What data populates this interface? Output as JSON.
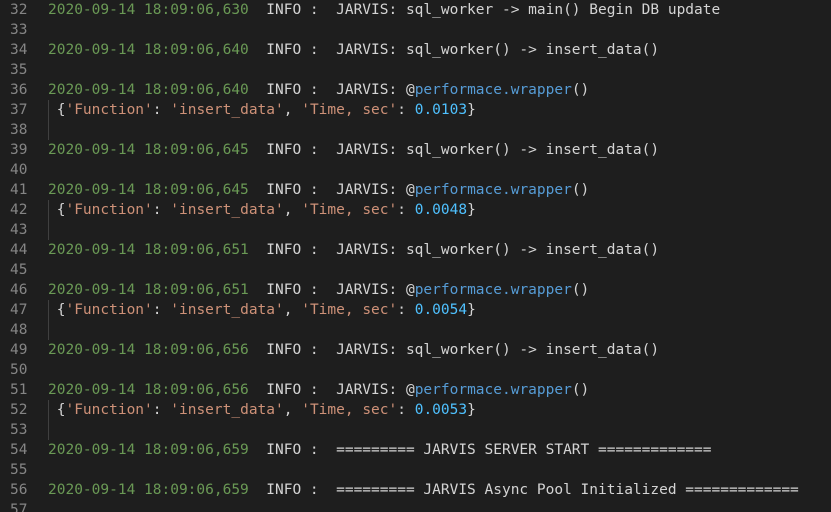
{
  "colors": {
    "background": "#1e1e1e",
    "line_number": "#858585",
    "timestamp": "#6a9955",
    "text": "#d4d4d4",
    "string": "#ce9178",
    "decorator_name": "#569cd6",
    "number": "#4fc1ff"
  },
  "lines": [
    {
      "n": "32",
      "kind": "log",
      "ts": "2020-09-14 18:09:06,630",
      "level": "INFO",
      "msg": "JARVIS: sql_worker -> main() Begin DB update"
    },
    {
      "n": "33",
      "kind": "blank"
    },
    {
      "n": "34",
      "kind": "log",
      "ts": "2020-09-14 18:09:06,640",
      "level": "INFO",
      "msg": "JARVIS: sql_worker() -> insert_data()"
    },
    {
      "n": "35",
      "kind": "blank"
    },
    {
      "n": "36",
      "kind": "deco",
      "ts": "2020-09-14 18:09:06,640",
      "level": "INFO",
      "prefix": "JARVIS: @",
      "deco": "performace.wrapper",
      "suffix": "()"
    },
    {
      "n": "37",
      "kind": "dict",
      "key1": "'Function'",
      "val1": "'insert_data'",
      "key2": "'Time, sec'",
      "num": "0.0103"
    },
    {
      "n": "38",
      "kind": "guide"
    },
    {
      "n": "39",
      "kind": "log",
      "ts": "2020-09-14 18:09:06,645",
      "level": "INFO",
      "msg": "JARVIS: sql_worker() -> insert_data()"
    },
    {
      "n": "40",
      "kind": "blank"
    },
    {
      "n": "41",
      "kind": "deco",
      "ts": "2020-09-14 18:09:06,645",
      "level": "INFO",
      "prefix": "JARVIS: @",
      "deco": "performace.wrapper",
      "suffix": "()"
    },
    {
      "n": "42",
      "kind": "dict",
      "key1": "'Function'",
      "val1": "'insert_data'",
      "key2": "'Time, sec'",
      "num": "0.0048"
    },
    {
      "n": "43",
      "kind": "guide"
    },
    {
      "n": "44",
      "kind": "log",
      "ts": "2020-09-14 18:09:06,651",
      "level": "INFO",
      "msg": "JARVIS: sql_worker() -> insert_data()"
    },
    {
      "n": "45",
      "kind": "blank"
    },
    {
      "n": "46",
      "kind": "deco",
      "ts": "2020-09-14 18:09:06,651",
      "level": "INFO",
      "prefix": "JARVIS: @",
      "deco": "performace.wrapper",
      "suffix": "()"
    },
    {
      "n": "47",
      "kind": "dict",
      "key1": "'Function'",
      "val1": "'insert_data'",
      "key2": "'Time, sec'",
      "num": "0.0054"
    },
    {
      "n": "48",
      "kind": "guide"
    },
    {
      "n": "49",
      "kind": "log",
      "ts": "2020-09-14 18:09:06,656",
      "level": "INFO",
      "msg": "JARVIS: sql_worker() -> insert_data()"
    },
    {
      "n": "50",
      "kind": "blank"
    },
    {
      "n": "51",
      "kind": "deco",
      "ts": "2020-09-14 18:09:06,656",
      "level": "INFO",
      "prefix": "JARVIS: @",
      "deco": "performace.wrapper",
      "suffix": "()"
    },
    {
      "n": "52",
      "kind": "dict",
      "key1": "'Function'",
      "val1": "'insert_data'",
      "key2": "'Time, sec'",
      "num": "0.0053"
    },
    {
      "n": "53",
      "kind": "guide"
    },
    {
      "n": "54",
      "kind": "log",
      "ts": "2020-09-14 18:09:06,659",
      "level": "INFO",
      "msg": "========= JARVIS SERVER START ============="
    },
    {
      "n": "55",
      "kind": "blank"
    },
    {
      "n": "56",
      "kind": "log",
      "ts": "2020-09-14 18:09:06,659",
      "level": "INFO",
      "msg": "========= JARVIS Async Pool Initialized ============="
    },
    {
      "n": "57",
      "kind": "blank"
    }
  ]
}
